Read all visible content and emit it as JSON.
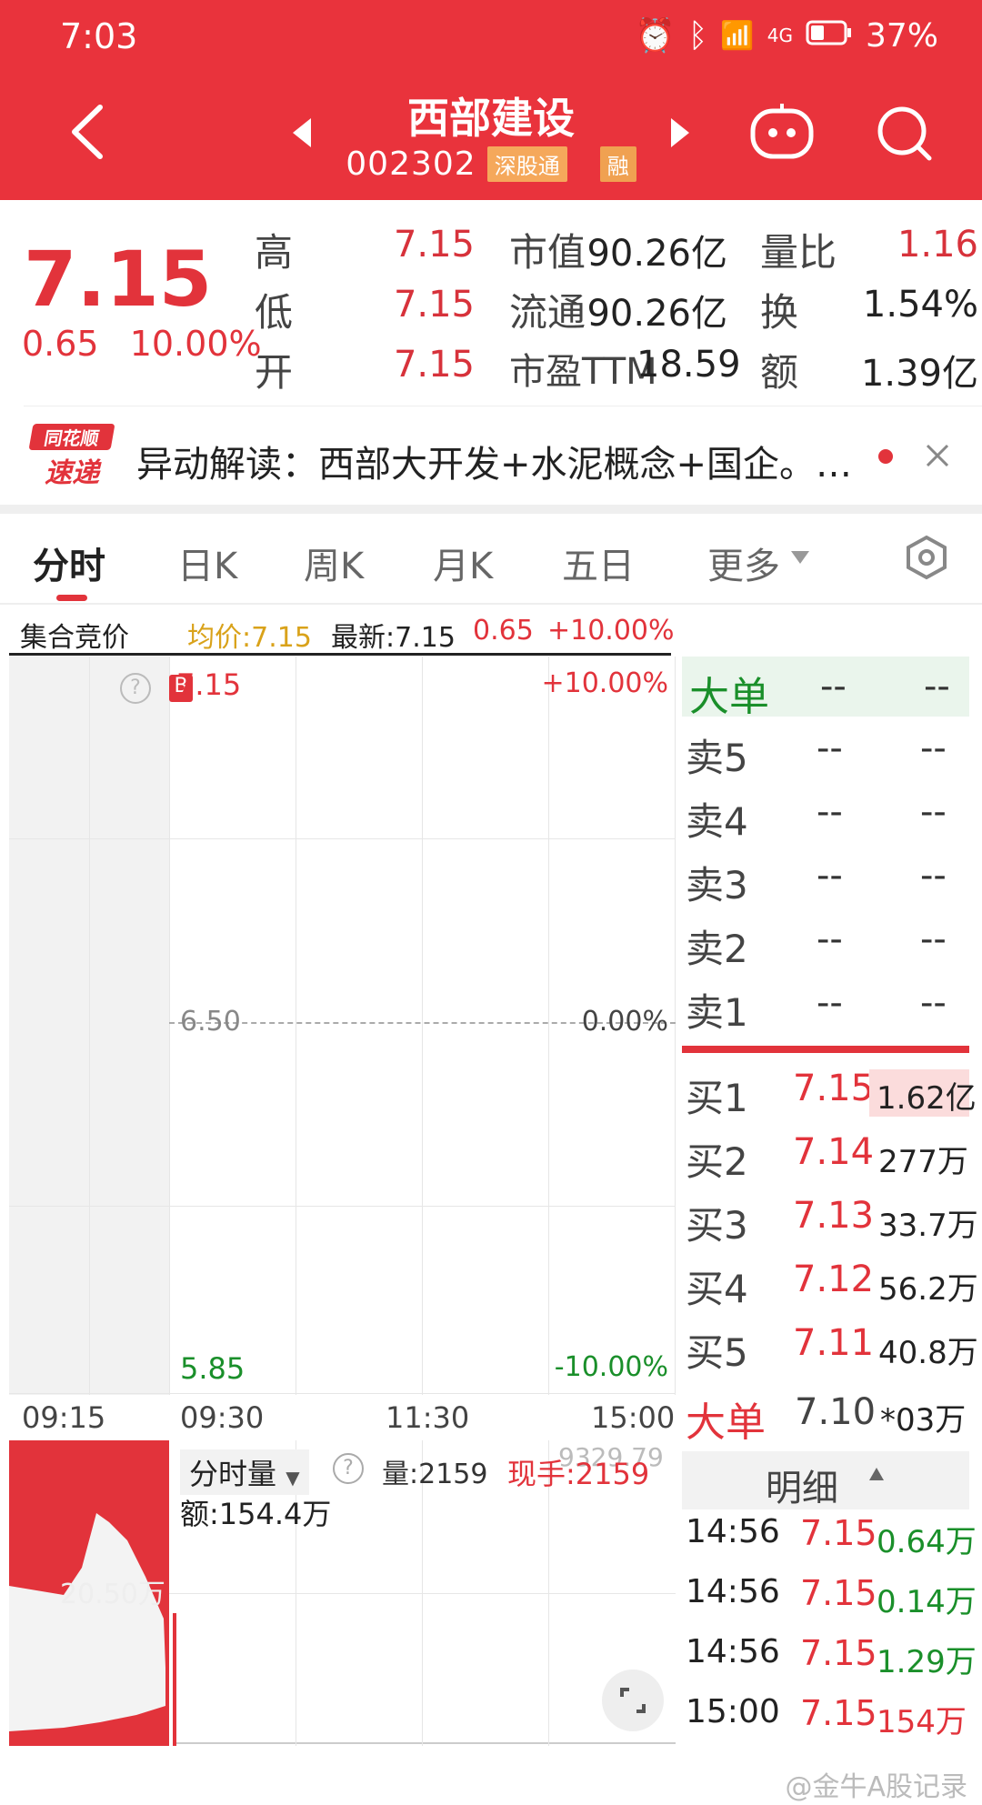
{
  "status": {
    "time": "7:03",
    "network": "4G",
    "battery": "37%"
  },
  "header": {
    "title": "西部建设",
    "code": "002302",
    "tag1": "深股通",
    "tag2": "融"
  },
  "quote": {
    "price": "7.15",
    "change": "0.65",
    "change_pct": "10.00%",
    "high_label": "高",
    "high": "7.15",
    "low_label": "低",
    "low": "7.15",
    "open_label": "开",
    "open": "7.15",
    "mcap_label": "市值",
    "mcap": "90.26亿",
    "float_label": "流通",
    "float": "90.26亿",
    "pe_label": "市盈TTM",
    "pe": "18.59",
    "vol_ratio_label": "量比",
    "vol_ratio": "1.16",
    "turnover_label": "换",
    "turnover": "1.54%",
    "amount_label": "额",
    "amount": "1.39亿"
  },
  "news": {
    "logo_top": "同花顺",
    "logo_bottom": "速递",
    "text": "异动解读：西部大开发+水泥概念+国企。…"
  },
  "tabs": [
    "分时",
    "日K",
    "周K",
    "月K",
    "五日",
    "更多"
  ],
  "info": {
    "auction": "集合竞价",
    "avg": "均价:7.15",
    "latest": "最新:7.15",
    "chg": "0.65",
    "pct": "+10.00%"
  },
  "chart": {
    "top_price": "7.15",
    "top_pct": "+10.00%",
    "mid_price": "6.50",
    "mid_pct": "0.00%",
    "bot_price": "5.85",
    "bot_pct": "-10.00%",
    "times": [
      "09:15",
      "09:30",
      "11:30",
      "15:00"
    ],
    "vol_label": "分时量",
    "vol": "量:2159",
    "now_hand": "现手:2159",
    "overlay": "9329.79",
    "amount": "额:154.4万",
    "auction_vol": "20.50万"
  },
  "orderbook": {
    "big_label": "大单",
    "dash": "--",
    "sells": [
      "卖5",
      "卖4",
      "卖3",
      "卖2",
      "卖1"
    ],
    "buys": [
      {
        "label": "买1",
        "price": "7.15",
        "vol": "1.62亿"
      },
      {
        "label": "买2",
        "price": "7.14",
        "vol": "277万"
      },
      {
        "label": "买3",
        "price": "7.13",
        "vol": "33.7万"
      },
      {
        "label": "买4",
        "price": "7.12",
        "vol": "56.2万"
      },
      {
        "label": "买5",
        "price": "7.11",
        "vol": "40.8万"
      }
    ],
    "big_bottom_label": "大单",
    "big_bottom_price": "7.10",
    "big_bottom_vol": "*03万",
    "detail_label": "明细",
    "details": [
      {
        "time": "14:56",
        "price": "7.15",
        "vol": "0.64万"
      },
      {
        "time": "14:56",
        "price": "7.15",
        "vol": "0.14万"
      },
      {
        "time": "14:56",
        "price": "7.15",
        "vol": "1.29万"
      },
      {
        "time": "15:00",
        "price": "7.15",
        "vol": "154万"
      }
    ]
  },
  "watermark": "@金牛A股记录",
  "colors": {
    "red": "#e2333b",
    "header": "#e9333c",
    "green": "#1a8f2a"
  }
}
